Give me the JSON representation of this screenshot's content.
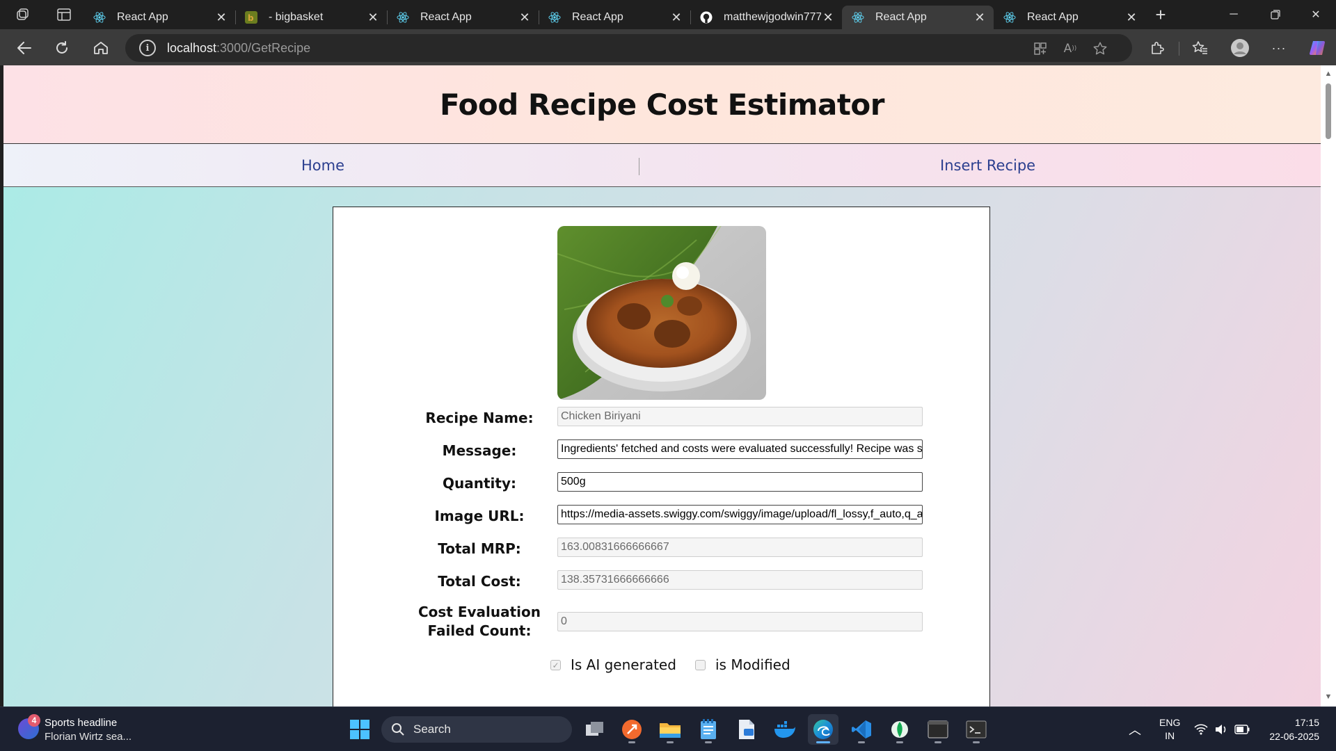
{
  "browser": {
    "tabs": [
      {
        "title": "React App",
        "favicon": "react-icon",
        "active": false
      },
      {
        "title": "- bigbasket",
        "favicon": "bigbasket-icon",
        "active": false
      },
      {
        "title": "React App",
        "favicon": "react-icon",
        "active": false
      },
      {
        "title": "React App",
        "favicon": "react-icon",
        "active": false
      },
      {
        "title": "matthewjgodwin777/",
        "favicon": "github-icon",
        "active": false
      },
      {
        "title": "React App",
        "favicon": "react-icon",
        "active": true
      },
      {
        "title": "React App",
        "favicon": "react-icon",
        "active": false
      }
    ],
    "url_host": "localhost",
    "url_path": ":3000/GetRecipe"
  },
  "app": {
    "title": "Food Recipe Cost Estimator",
    "nav": {
      "home": "Home",
      "insert": "Insert Recipe"
    },
    "form": {
      "recipe_name": {
        "label": "Recipe Name:",
        "value": "Chicken Biriyani"
      },
      "message": {
        "label": "Message:",
        "value": "Ingredients' fetched and costs were evaluated successfully! Recipe was saved."
      },
      "quantity": {
        "label": "Quantity:",
        "value": "500g"
      },
      "image_url": {
        "label": "Image URL:",
        "value": "https://media-assets.swiggy.com/swiggy/image/upload/fl_lossy,f_auto,q_auto"
      },
      "total_mrp": {
        "label": "Total MRP:",
        "value": "163.00831666666667"
      },
      "total_cost": {
        "label": "Total Cost:",
        "value": "138.35731666666666"
      },
      "failed_count": {
        "label": "Cost Evaluation Failed Count:",
        "value": "0"
      },
      "ai_generated": {
        "label": "Is AI generated",
        "checked": true
      },
      "modified": {
        "label": "is Modified",
        "checked": false
      }
    },
    "colors": {
      "nav_link": "#2b3f8f",
      "title": "#111111"
    }
  },
  "taskbar": {
    "widget": {
      "badge": "4",
      "line1": "Sports headline",
      "line2": "Florian Wirtz sea..."
    },
    "search_label": "Search",
    "lang_line1": "ENG",
    "lang_line2": "IN",
    "time": "17:15",
    "date": "22-06-2025"
  }
}
